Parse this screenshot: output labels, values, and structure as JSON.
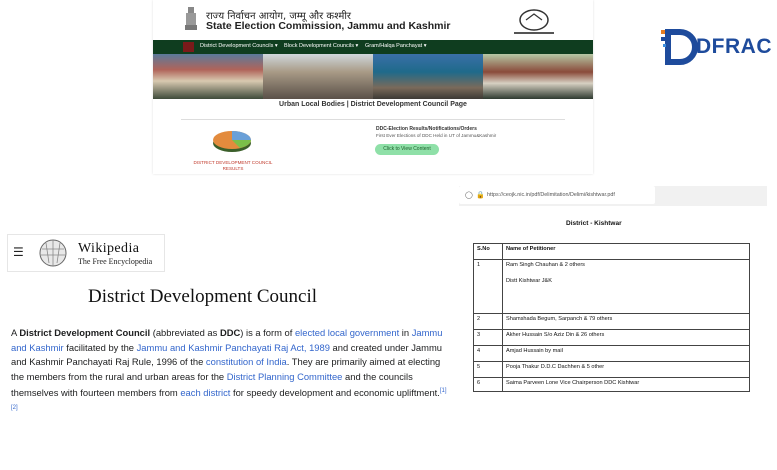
{
  "sec": {
    "hindi_title": "राज्य निर्वाचन आयोग, जम्मू और कश्मीर",
    "title": "State Election Commission, Jammu and Kashmir",
    "nav": [
      "District Development Councils ▾",
      "Block Development Councils ▾",
      "Gram/Halqa Panchayat ▾"
    ],
    "subtitle": "Urban Local Bodies | District Development Council Page",
    "results_label": "DISTRICT DEVELOPMENT COUNCIL RESULTS",
    "notice_title": "DDC-Election Results/Notifications/Orders",
    "notice_sub": "First Ever Elections of DDC Held in UT of Jammu&Kashmir",
    "view_button": "Click to View Content",
    "colors": {
      "nav": "#0f3d1f",
      "button": "#8fe0a8"
    }
  },
  "dfrac": {
    "logo_text": "DFRAC"
  },
  "wikipedia": {
    "wordmark": "Wikipedia",
    "tagline": "The Free Encyclopedia",
    "article_title": "District Development Council",
    "para": {
      "t1": "A ",
      "b1": "District Development Council",
      "t2": " (abbreviated as ",
      "b2": "DDC",
      "t3": ") is a form of ",
      "l1": "elected local government",
      "t4": " in ",
      "l2": "Jammu and Kashmir",
      "t5": " facilitated by the ",
      "l3": "Jammu and Kashmir Panchayati Raj Act, 1989",
      "t6": " and created under Jammu and Kashmir Panchayati Raj Rule, 1996 of the ",
      "l4": "constitution of India",
      "t7": ". They are primarily aimed at electing the members from the rural and urban areas for the ",
      "l5": "District Planning Committee",
      "t8": " and the councils themselves with fourteen members from ",
      "l6": "each district",
      "t9": " for speedy development and economic upliftment.",
      "refs": "[1][2]"
    }
  },
  "pdf": {
    "url": "https://ceojk.nic.in/pdf/Delimitation/Delimi/kishtwar.pdf",
    "doc_title": "District - Kishtwar",
    "headers": [
      "S.No",
      "Name of Petitioner"
    ],
    "rows": [
      {
        "sn": "1",
        "name": "Ram Singh Chauhan & 2 others",
        "extra": "Distt Kishtwar J&K"
      },
      {
        "sn": "2",
        "name": "Shamshada Begum, Sarpanch & 79 others"
      },
      {
        "sn": "3",
        "name": "Akher Hussain S/o Aziz Din & 26 others"
      },
      {
        "sn": "4",
        "name": "Amjad Hussain by mail"
      },
      {
        "sn": "5",
        "name": "Pooja Thakur D.D.C Dachhen & 5 other"
      },
      {
        "sn": "6",
        "name": "Saima Parveen Lone Vice Chairperson DDC Kishtwar"
      }
    ]
  }
}
